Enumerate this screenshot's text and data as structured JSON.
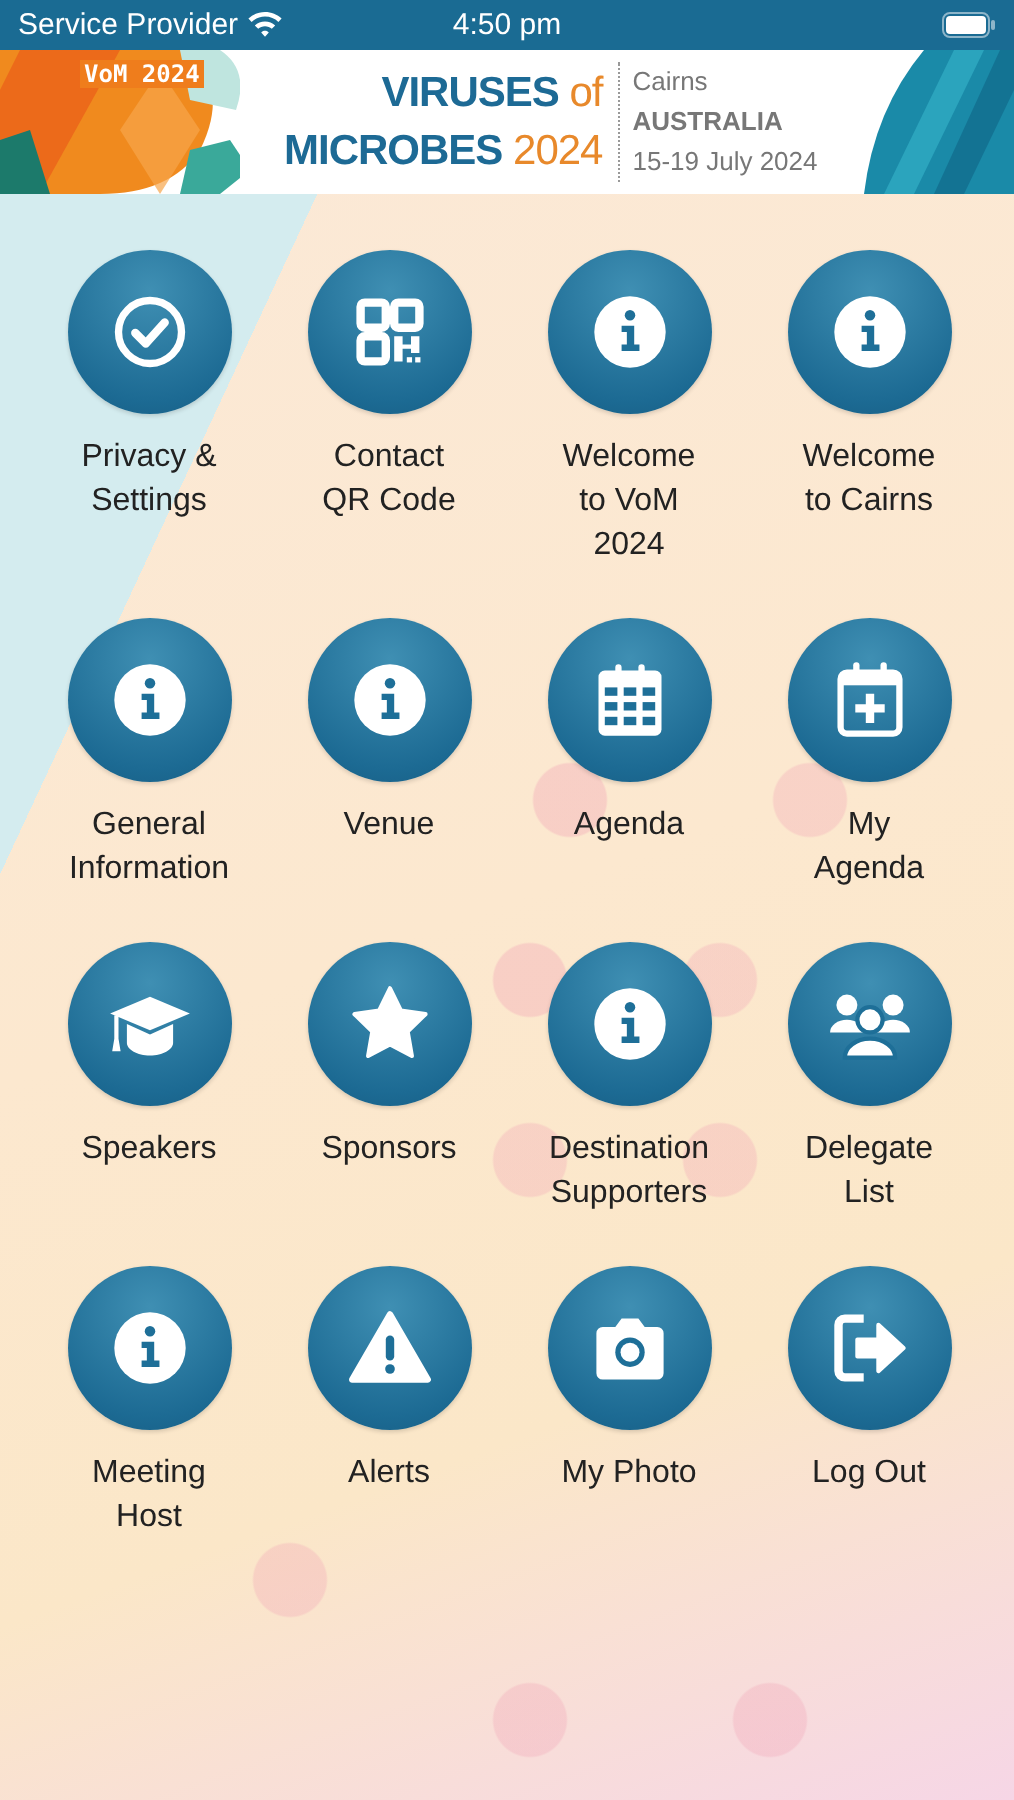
{
  "status_bar": {
    "carrier": "Service Provider",
    "time": "4:50 pm"
  },
  "banner": {
    "badge": "VoM 2024",
    "title_lines": [
      {
        "main": "VIRUSES",
        "accent": "of"
      },
      {
        "main": "MICROBES",
        "accent": "2024"
      }
    ],
    "city": "Cairns",
    "country": "AUSTRALIA",
    "dates": "15-19 July 2024"
  },
  "menu": [
    {
      "label": "Privacy &\nSettings",
      "kind": "check"
    },
    {
      "label": "Contact\nQR Code",
      "kind": "qr"
    },
    {
      "label": "Welcome\nto VoM\n2024",
      "kind": "info"
    },
    {
      "label": "Welcome\nto Cairns",
      "kind": "info"
    },
    {
      "label": "General\nInformation",
      "kind": "info"
    },
    {
      "label": "Venue",
      "kind": "info"
    },
    {
      "label": "Agenda",
      "kind": "calendar"
    },
    {
      "label": "My\nAgenda",
      "kind": "calendar-plus"
    },
    {
      "label": "Speakers",
      "kind": "cap"
    },
    {
      "label": "Sponsors",
      "kind": "star"
    },
    {
      "label": "Destination\nSupporters",
      "kind": "info"
    },
    {
      "label": "Delegate\nList",
      "kind": "people"
    },
    {
      "label": "Meeting\nHost",
      "kind": "info"
    },
    {
      "label": "Alerts",
      "kind": "alert"
    },
    {
      "label": "My Photo",
      "kind": "camera"
    },
    {
      "label": "Log Out",
      "kind": "logout"
    }
  ]
}
